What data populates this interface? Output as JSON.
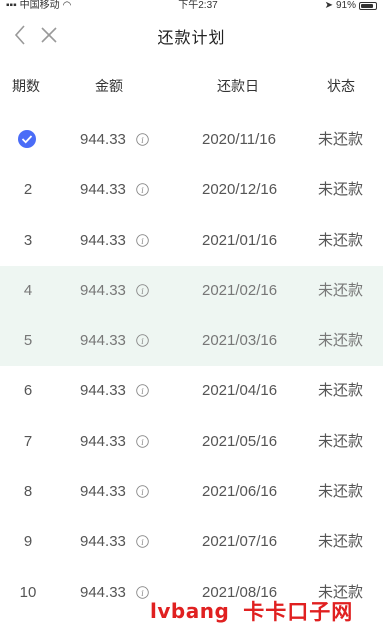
{
  "status_bar": {
    "carrier": "中国移动",
    "time": "下午2:37",
    "battery_percent": "91%"
  },
  "nav": {
    "title": "还款计划",
    "back_icon": "chevron-left-icon",
    "close_icon": "close-icon"
  },
  "table": {
    "headers": [
      "期数",
      "金额",
      "还款日",
      "状态"
    ],
    "rows": [
      {
        "period": "",
        "completed": true,
        "amount": "944.33",
        "date": "2020/11/16",
        "status": "未还款"
      },
      {
        "period": "2",
        "amount": "944.33",
        "date": "2020/12/16",
        "status": "未还款"
      },
      {
        "period": "3",
        "amount": "944.33",
        "date": "2021/01/16",
        "status": "未还款"
      },
      {
        "period": "4",
        "amount": "944.33",
        "date": "2021/02/16",
        "status": "未还款"
      },
      {
        "period": "5",
        "amount": "944.33",
        "date": "2021/03/16",
        "status": "未还款"
      },
      {
        "period": "6",
        "amount": "944.33",
        "date": "2021/04/16",
        "status": "未还款"
      },
      {
        "period": "7",
        "amount": "944.33",
        "date": "2021/05/16",
        "status": "未还款"
      },
      {
        "period": "8",
        "amount": "944.33",
        "date": "2021/06/16",
        "status": "未还款"
      },
      {
        "period": "9",
        "amount": "944.33",
        "date": "2021/07/16",
        "status": "未还款"
      },
      {
        "period": "10",
        "amount": "944.33",
        "date": "2021/08/16",
        "status": "未还款"
      }
    ]
  },
  "watermark": {
    "en": "lvbang",
    "cn": "卡卡口子网"
  },
  "colors": {
    "accent": "#4a6cf7",
    "highlight_band": "#eef6f2",
    "watermark": "#e02020"
  }
}
